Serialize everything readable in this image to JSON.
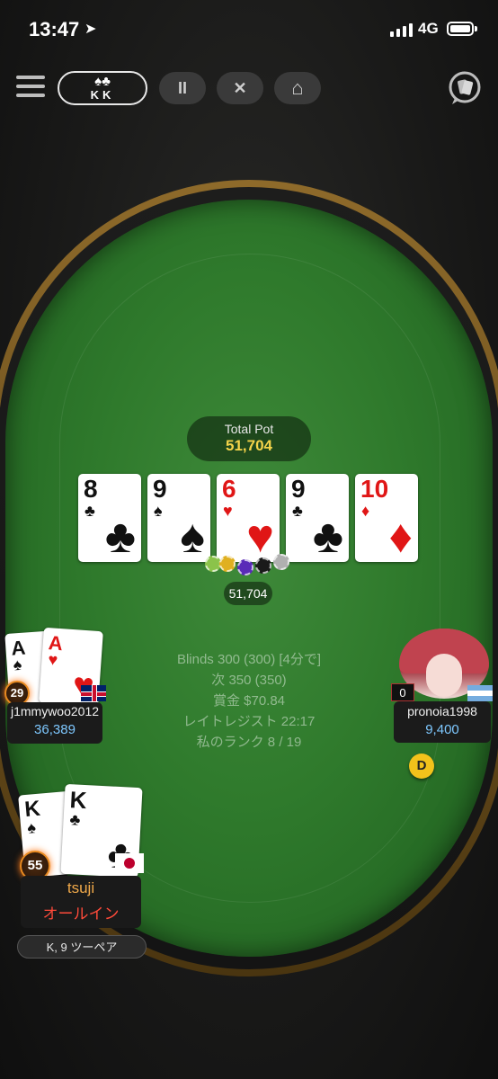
{
  "status_bar": {
    "time": "13:47",
    "network": "4G"
  },
  "toolbar": {
    "hand_suits": "♠♣",
    "hand_ranks": "KK",
    "pause_label": "II",
    "close_label": "✕",
    "home_label": "⌂"
  },
  "pot": {
    "label": "Total Pot",
    "value": "51,704",
    "chip_value": "51,704"
  },
  "board": [
    {
      "rank": "8",
      "suit": "♣"
    },
    {
      "rank": "9",
      "suit": "♠"
    },
    {
      "rank": "6",
      "suit": "♥"
    },
    {
      "rank": "9",
      "suit": "♣"
    },
    {
      "rank": "10",
      "suit": "♦"
    }
  ],
  "info": {
    "blinds": "Blinds 300 (300) [4分で]",
    "next": "次 350 (350)",
    "prize": "賞金 $70.84",
    "late_reg": "レイトレジスト 22:17",
    "my_rank": "私のランク 8 / 19"
  },
  "players": {
    "left": {
      "name": "j1mmywoo2012",
      "stack": "36,389",
      "level": "29",
      "cards": [
        {
          "rank": "A",
          "suit": "♠"
        },
        {
          "rank": "A",
          "suit": "♥"
        }
      ]
    },
    "right": {
      "name": "pronoia1998",
      "stack": "9,400",
      "bet_count": "0",
      "dealer_label": "D"
    },
    "hero": {
      "name": "tsuji",
      "status": "オールイン",
      "level": "55",
      "hand_desc": "K, 9 ツーペア",
      "cards": [
        {
          "rank": "K",
          "suit": "♠"
        },
        {
          "rank": "K",
          "suit": "♣"
        }
      ]
    }
  }
}
